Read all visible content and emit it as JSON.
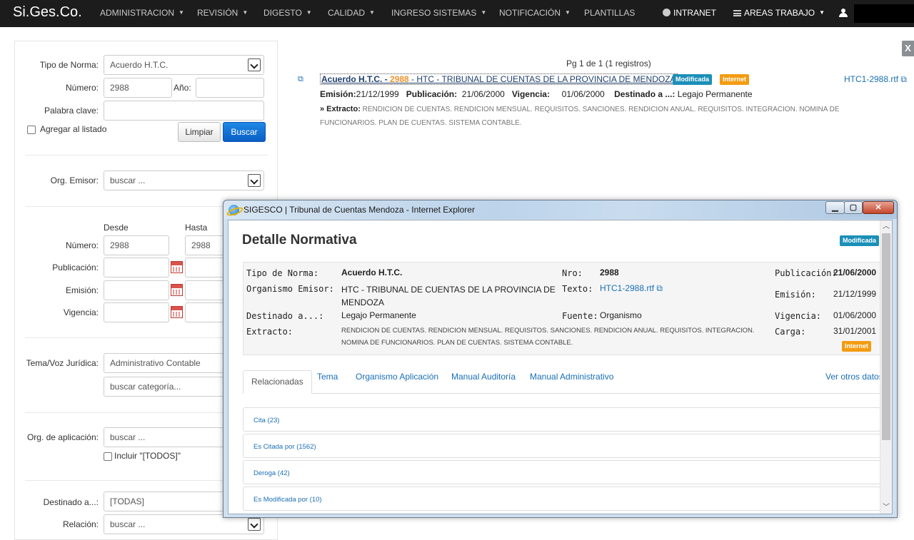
{
  "nav": {
    "brand": "Si.Ges.Co.",
    "items": [
      {
        "label": "ADMINISTRACION",
        "caret": true
      },
      {
        "label": "REVISIÓN",
        "caret": true
      },
      {
        "label": "DIGESTO",
        "caret": true
      },
      {
        "label": "CALIDAD",
        "caret": true
      },
      {
        "label": "INGRESO SISTEMAS",
        "caret": true
      },
      {
        "label": "NOTIFICACIÓN",
        "caret": true
      },
      {
        "label": "PLANTILLAS",
        "caret": false
      }
    ],
    "intranet": "INTRANET",
    "areas": "AREAS TRABAJO"
  },
  "filters": {
    "tipo_norma": {
      "label": "Tipo de Norma:",
      "value": "Acuerdo H.T.C."
    },
    "numero": {
      "label": "Número:",
      "value": "2988"
    },
    "anio": {
      "label": "Año:",
      "value": ""
    },
    "palabra_clave": {
      "label": "Palabra clave:",
      "value": ""
    },
    "agregar_listado": "Agregar al listado",
    "btn_limpiar": "Limpiar",
    "btn_buscar": "Buscar",
    "org_emisor": {
      "label": "Org. Emisor:",
      "value": "buscar ..."
    },
    "desde": "Desde",
    "hasta": "Hasta",
    "rango_numero": {
      "label": "Número:",
      "desde": "2988",
      "hasta": "2988"
    },
    "publicacion": "Publicación:",
    "emision": "Emisión:",
    "vigencia": "Vigencia:",
    "tema": {
      "label": "Tema/Voz Jurídica:",
      "value": "Administrativo Contable",
      "categoria": "buscar categoría..."
    },
    "org_aplicacion": {
      "label": "Org. de aplicación:",
      "value": "buscar ...",
      "incluir": "Incluir \"[TODOS]\""
    },
    "destinado": {
      "label": "Destinado a...:",
      "value": "[TODAS]"
    },
    "relacion": {
      "label": "Relación:",
      "value": "buscar ..."
    }
  },
  "results": {
    "pager": "Pg 1 de 1 (1 registros)",
    "item": {
      "title_prefix": "Acuerdo H.T.C.  -  ",
      "number": "2988",
      "title_suffix": "  - HTC - TRIBUNAL DE CUENTAS DE LA PROVINCIA DE MENDOZA",
      "badge_modificada": "Modificada",
      "badge_internet": "Internet",
      "file_link": "HTC1-2988.rtf",
      "emision_label": "Emisión:",
      "emision": "21/12/1999",
      "publicacion_label": "Publicación:",
      "publicacion": "21/06/2000",
      "vigencia_label": "Vigencia:",
      "vigencia": "01/06/2000",
      "destinado_label": "Destinado a ...:",
      "destinado": "Legajo Permanente",
      "extracto_label": "» Extracto:",
      "extracto": "RENDICION DE CUENTAS. RENDICION MENSUAL. REQUISITOS. SANCIONES. RENDICION ANUAL. REQUISITOS. INTEGRACION. NOMINA DE FUNCIONARIOS. PLAN DE CUENTAS. SISTEMA CONTABLE."
    }
  },
  "popup": {
    "window_title": "SIGESCO | Tribunal de Cuentas Mendoza - Internet Explorer",
    "heading": "Detalle Normativa",
    "badge_modificada": "Modificada",
    "badge_internet": "Internet",
    "info": {
      "tipo_label": "Tipo de Norma:",
      "tipo": "Acuerdo H.T.C.",
      "org_label": "Organismo Emisor:",
      "org": "HTC - TRIBUNAL DE CUENTAS DE LA PROVINCIA DE MENDOZA",
      "dest_label": "Destinado a...:",
      "dest": "Legajo Permanente",
      "extr_label": "Extracto:",
      "extr": "RENDICION DE CUENTAS. RENDICION MENSUAL. REQUISITOS. SANCIONES. RENDICION ANUAL. REQUISITOS. INTEGRACION. NOMINA DE FUNCIONARIOS. PLAN DE CUENTAS. SISTEMA CONTABLE.",
      "nro_label": "Nro:",
      "nro": "2988",
      "texto_label": "Texto:",
      "texto": "HTC1-2988.rtf",
      "fuente_label": "Fuente:",
      "fuente": "Organismo",
      "pub_label": "Publicación:",
      "pub": "21/06/2000",
      "emi_label": "Emisión:",
      "emi": "21/12/1999",
      "vig_label": "Vigencia:",
      "vig": "01/06/2000",
      "carga_label": "Carga:",
      "carga": "31/01/2001"
    },
    "tabs": [
      "Relacionadas",
      "Tema",
      "Organismo Aplicación",
      "Manual Auditoría",
      "Manual Administrativo"
    ],
    "ver_otros": "Ver otros datos",
    "relations": [
      "Cita (23)",
      "Es Citada por (1562)",
      "Deroga (42)",
      "Es Modificada por (10)"
    ]
  }
}
